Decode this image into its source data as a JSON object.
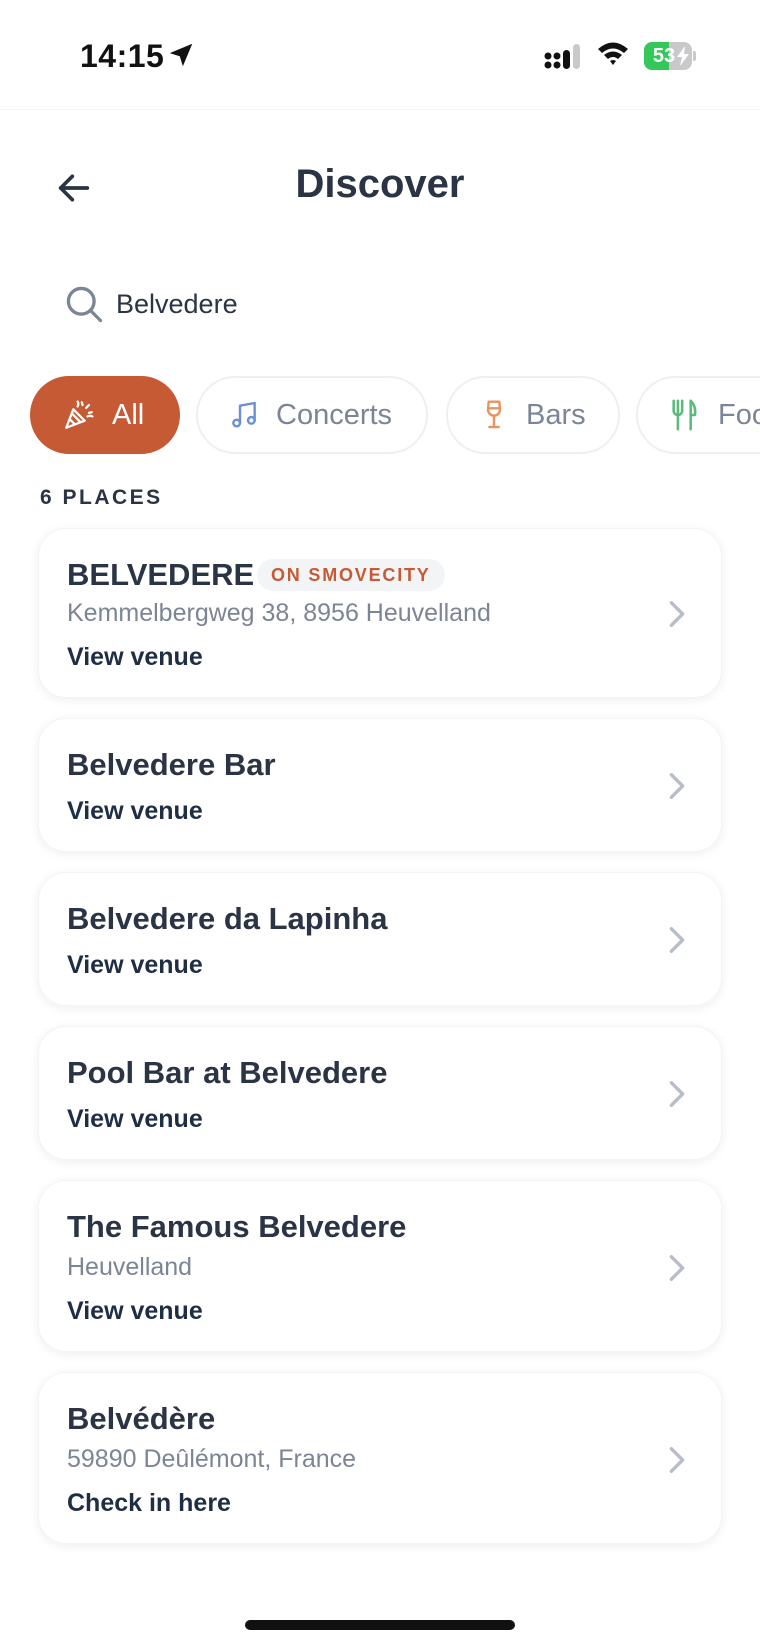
{
  "status_bar": {
    "time": "14:15",
    "battery": "53",
    "battery_level": 0.53,
    "icons": [
      "location-arrow-icon",
      "cellular-signal-icon",
      "wifi-icon",
      "battery-charging-icon"
    ]
  },
  "header": {
    "title": "Discover",
    "back_icon": "arrow-left-icon"
  },
  "search": {
    "value": "Belvedere",
    "icon": "search-icon"
  },
  "filters": [
    {
      "label": "All",
      "icon": "party-popper-icon",
      "active": true
    },
    {
      "label": "Concerts",
      "icon": "music-note-icon",
      "active": false
    },
    {
      "label": "Bars",
      "icon": "wine-glass-icon",
      "active": false
    },
    {
      "label": "Food",
      "icon": "fork-knife-icon",
      "active": false
    }
  ],
  "places": {
    "count_label": "6 PLACES",
    "items": [
      {
        "name": "BELVEDERE",
        "badge": "ON SMOVECITY",
        "subtitle": "Kemmelbergweg 38,  8956 Heuvelland",
        "action": "View venue"
      },
      {
        "name": "Belvedere Bar",
        "action": "View venue"
      },
      {
        "name": "Belvedere da Lapinha",
        "action": "View venue"
      },
      {
        "name": "Pool Bar at Belvedere",
        "action": "View venue"
      },
      {
        "name": "The Famous Belvedere",
        "subtitle": "Heuvelland",
        "action": "View venue"
      },
      {
        "name": "Belvédère",
        "subtitle": "59890 Deûlémont, France",
        "action": "Check in here"
      }
    ]
  },
  "colors": {
    "accent": "#c65a35",
    "text_dark": "#2b3445",
    "text_muted": "#7b8596",
    "concerts_icon": "#6b8fd6",
    "bars_icon": "#e8935e",
    "food_icon": "#5cba7d",
    "battery_green": "#34c759"
  }
}
